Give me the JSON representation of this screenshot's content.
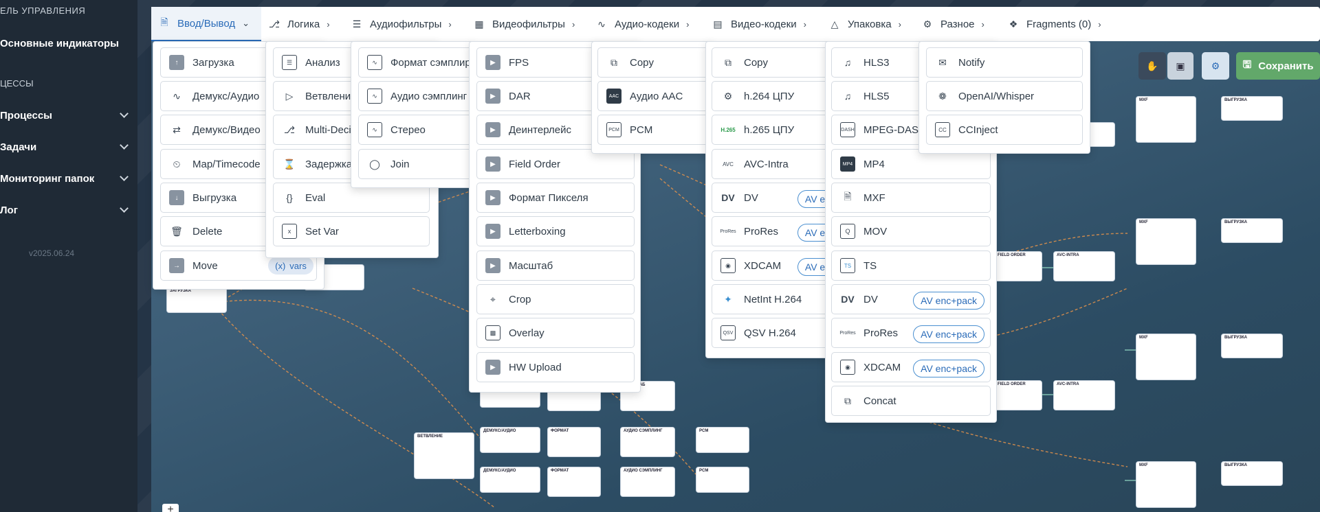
{
  "sidebar": {
    "title": "ЕЛЬ УПРАВЛЕНИЯ",
    "dashboard": "Основные индикаторы",
    "section": "ЦЕССЫ",
    "items": [
      "Процессы",
      "Задачи",
      "Мониторинг папок",
      "Лог"
    ],
    "version": "v2025.06.24"
  },
  "menubar": {
    "tabs": [
      {
        "label": "Ввод/Вывод",
        "icon": "file-io-icon"
      },
      {
        "label": "Логика",
        "icon": "logic-icon"
      },
      {
        "label": "Аудиофильтры",
        "icon": "sliders-icon"
      },
      {
        "label": "Видеофильтры",
        "icon": "video-filter-icon"
      },
      {
        "label": "Аудио-кодеки",
        "icon": "waveform-icon"
      },
      {
        "label": "Видео-кодеки",
        "icon": "video-codec-icon"
      },
      {
        "label": "Упаковка",
        "icon": "box-icon"
      },
      {
        "label": "Разное",
        "icon": "gear-icon"
      },
      {
        "label": "Fragments (0)",
        "icon": "puzzle-icon"
      }
    ]
  },
  "io_menu": [
    "Загрузка",
    "Демукс/Аудио",
    "Демукс/Видео",
    "Map/Timecode",
    "Выгрузка",
    "Delete",
    "Move"
  ],
  "io_vars": "vars",
  "logic_menu": [
    "Анализ",
    "Ветвление",
    "Multi-Deci",
    "Задержка",
    "Eval",
    "Set Var"
  ],
  "audio_filters": [
    "Формат сэмплиро",
    "Аудио сэмплинг",
    "Стерео",
    "Join"
  ],
  "video_filters": [
    "FPS",
    "DAR",
    "Деинтерлейс",
    "Field Order",
    "Формат Пикселя",
    "Letterboxing",
    "Масштаб",
    "Crop",
    "Overlay",
    "HW Upload"
  ],
  "audio_codecs": [
    "Copy",
    "Аудио AAC",
    "PCM"
  ],
  "video_codecs": [
    "Copy",
    "h.264 ЦПУ",
    "h.265 ЦПУ",
    "AVC-Intra",
    "DV",
    "ProRes",
    "XDCAM",
    "NetInt H.264",
    "QSV H.264"
  ],
  "video_codec_badge": "AV enc",
  "packaging": [
    "HLS3",
    "HLS5",
    "MPEG-DASH",
    "MP4",
    "MXF",
    "MOV",
    "TS",
    "DV",
    "ProRes",
    "XDCAM",
    "Concat"
  ],
  "packaging_badge": "AV enc+pack",
  "misc": [
    "Notify",
    "OpenAI/Whisper",
    "CCInject"
  ],
  "toolbar": {
    "save": "Сохранить"
  },
  "canvas_plus": "+"
}
